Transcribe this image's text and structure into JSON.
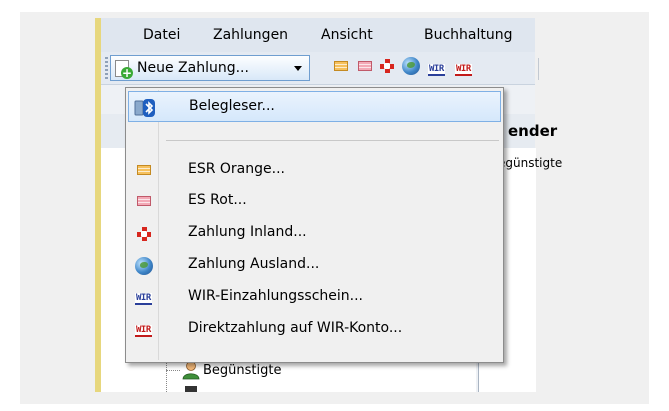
{
  "menubar": {
    "items": [
      "Datei",
      "Zahlungen",
      "Ansicht",
      "Buchhaltung"
    ]
  },
  "toolbar": {
    "new_payment_label": "Neue Zahlung...",
    "wir_label": "WIR"
  },
  "panel": {
    "header_fragment": "ender",
    "column_fragment": "egünstigte"
  },
  "tree": {
    "item_label": "Begünstigte"
  },
  "dropdown": {
    "items": [
      {
        "label": "Belegleser...",
        "icon": "bluetooth-reader-icon"
      },
      {
        "label": "ESR Orange...",
        "icon": "esr-orange-icon"
      },
      {
        "label": "ES Rot...",
        "icon": "es-red-icon"
      },
      {
        "label": "Zahlung Inland...",
        "icon": "swiss-cross-icon"
      },
      {
        "label": "Zahlung Ausland...",
        "icon": "globe-icon"
      },
      {
        "label": "WIR-Einzahlungsschein...",
        "icon": "wir-blue-icon"
      },
      {
        "label": "Direktzahlung auf WIR-Konto...",
        "icon": "wir-red-icon"
      }
    ]
  },
  "colors": {
    "highlight_border": "#7fb0e5",
    "menubar_bg": "#dfe6ef",
    "left_strip": "#e7d77d"
  }
}
